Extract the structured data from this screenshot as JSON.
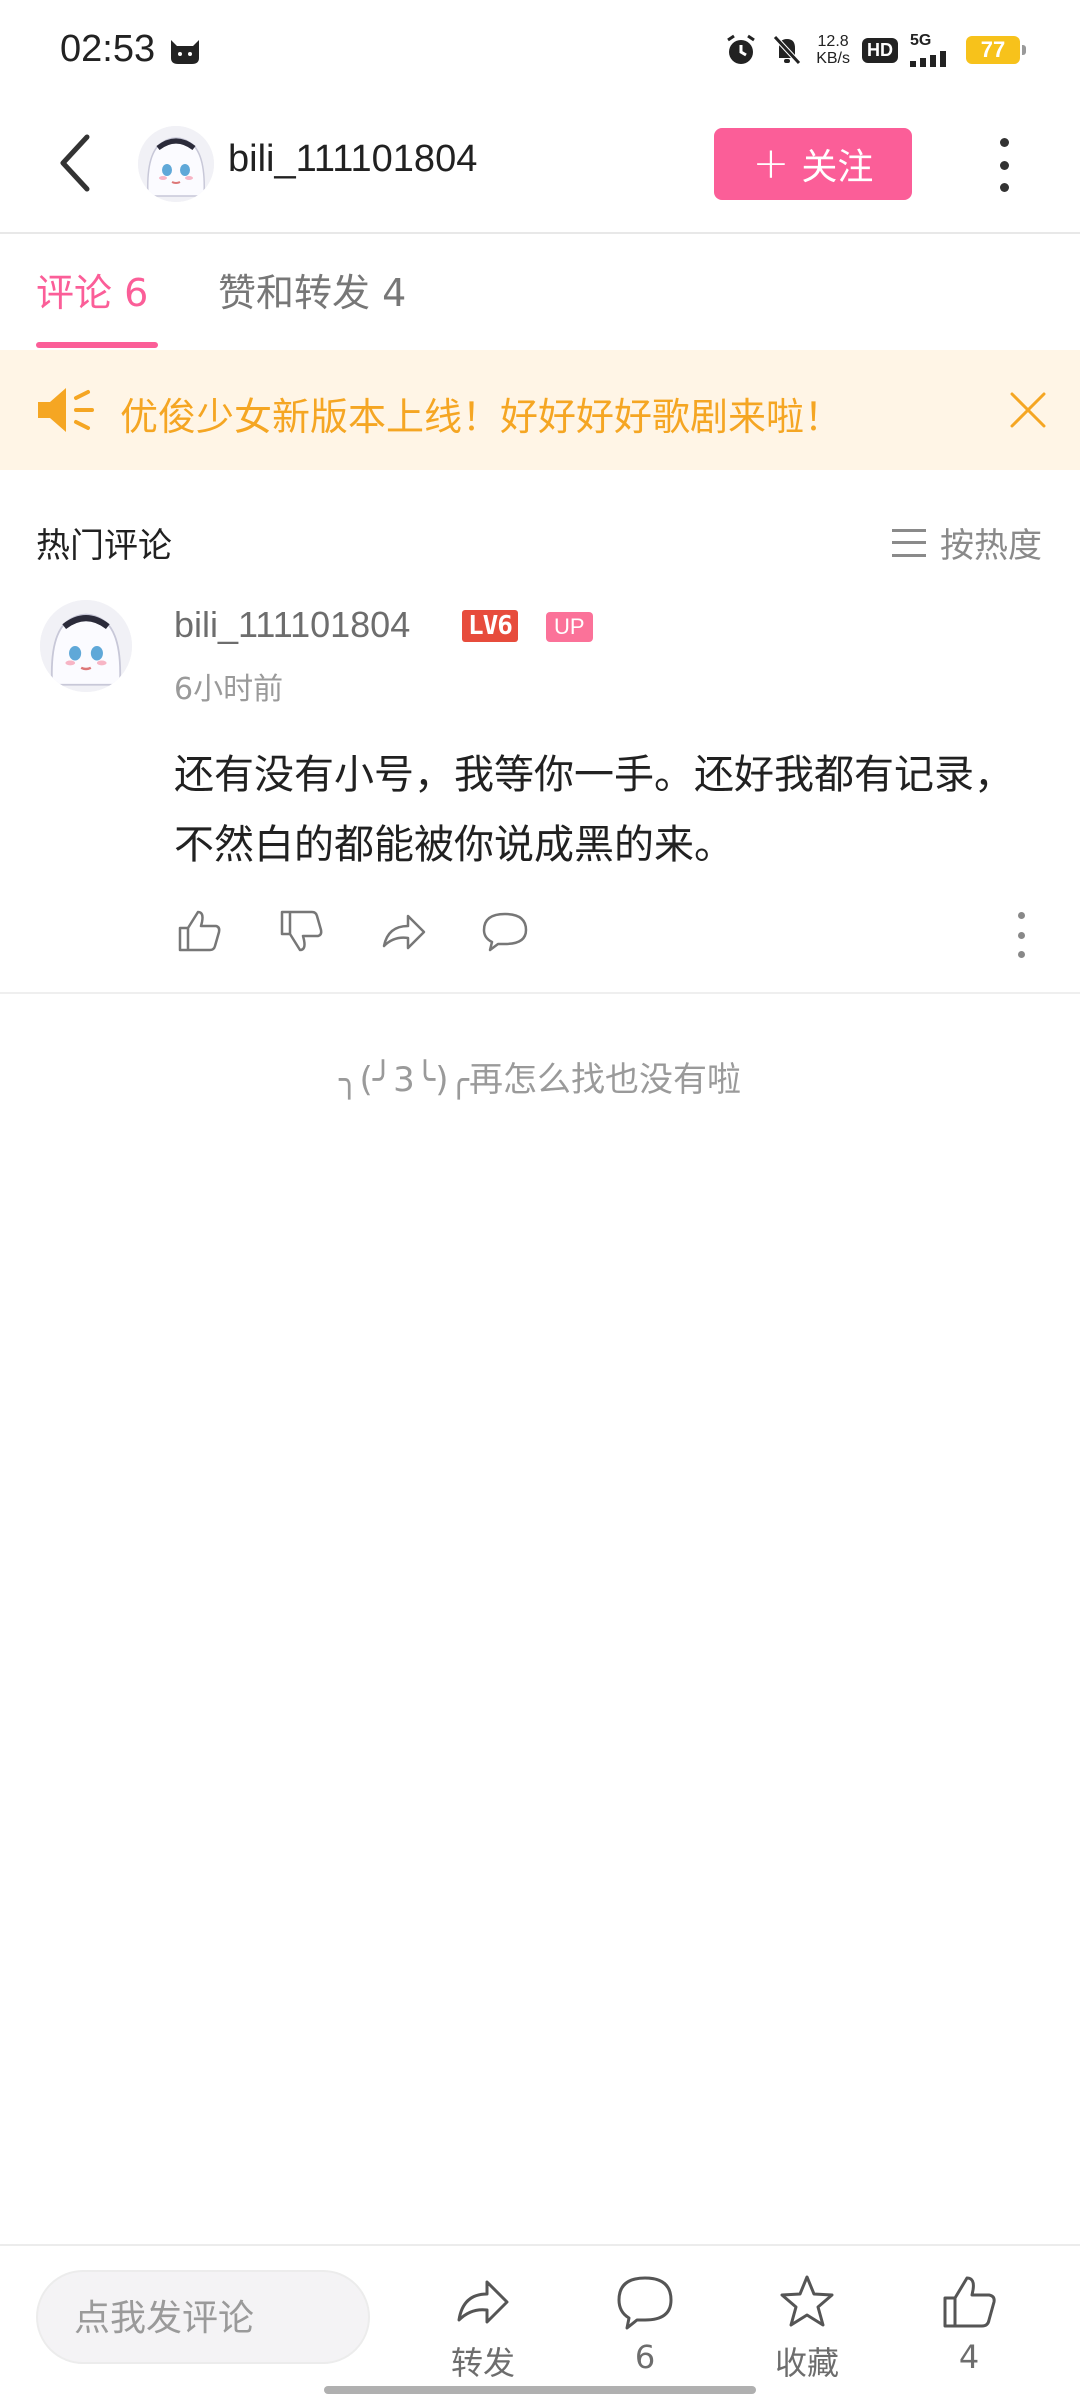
{
  "status_bar": {
    "time": "02:53",
    "net_speed_value": "12.8",
    "net_speed_unit": "KB/s",
    "hd": "HD",
    "network": "5G",
    "battery": "77"
  },
  "header": {
    "username": "bili_111101804",
    "follow_label": "关注"
  },
  "tabs": [
    {
      "label": "评论 6",
      "active": true
    },
    {
      "label": "赞和转发 4",
      "active": false
    }
  ],
  "banner": {
    "text": "优俊少女新版本上线！好好好好歌剧来啦！"
  },
  "hot_comments": {
    "title": "热门评论",
    "sort_label": "按热度"
  },
  "comment": {
    "username": "bili_111101804",
    "level": "LV6",
    "up_badge": "UP",
    "time": "6小时前",
    "body": "还有没有小号，我等你一手。还好我都有记录，不然白的都能被你说成黑的来。"
  },
  "end_text": "╮(╯3╰)╭再怎么找也没有啦",
  "bottom_bar": {
    "input_placeholder": "点我发评论",
    "repost_label": "转发",
    "comment_count": "6",
    "favorite_label": "收藏",
    "like_count": "4"
  },
  "colors": {
    "accent_pink": "#fb5e98",
    "banner_text": "#f5a623",
    "banner_bg": "#fff5e6",
    "level_badge": "#e74c3c"
  }
}
